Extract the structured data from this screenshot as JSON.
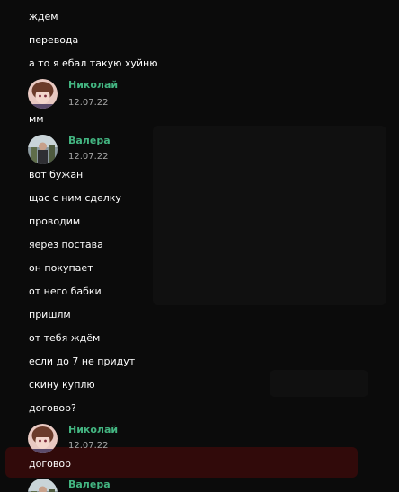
{
  "colors": {
    "background": "#0b0b0b",
    "author_name": "#43b581",
    "message_text": "#ffffff",
    "date_text": "#a8a8a8"
  },
  "messages_top": [
    "ждём",
    "перевода",
    "а то я ебал такую хуйню"
  ],
  "group_nikolay_1": {
    "author": "Николай",
    "date": "12.07.22",
    "avatar_icon": "anime-avatar-icon",
    "lines": [
      "мм"
    ]
  },
  "group_valera_1": {
    "author": "Валера",
    "date": "12.07.22",
    "avatar_icon": "photo-avatar-icon",
    "lines": [
      "вот бужан",
      "щас с ним сделку",
      "проводим",
      "яерез постава",
      "он покупает",
      "от него бабки",
      "пришлм",
      "от тебя ждём",
      "если до 7 не придут",
      "скину куплю",
      "договор?"
    ]
  },
  "group_nikolay_2": {
    "author": "Николай",
    "date": "12.07.22",
    "avatar_icon": "anime-avatar-icon",
    "lines": [
      "договор"
    ]
  },
  "group_valera_2": {
    "author": "Валера",
    "avatar_icon": "photo-avatar-icon"
  }
}
